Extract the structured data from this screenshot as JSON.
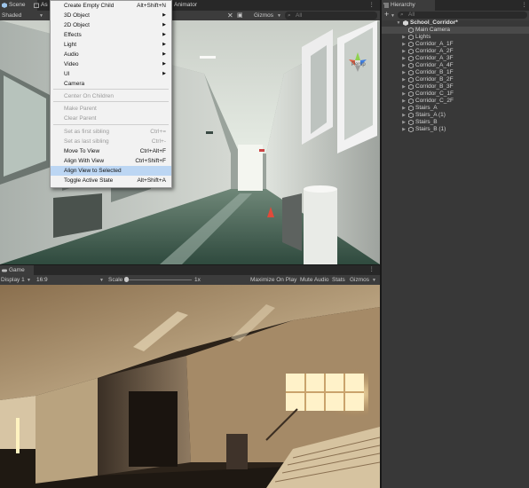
{
  "scene_tabs": {
    "scene": "Scene",
    "asset": "As",
    "animator": "Animator"
  },
  "scene_toolbar": {
    "shading_mode": "Shaded",
    "gizmos": "Gizmos",
    "search_placeholder": "All"
  },
  "scene_gizmo": {
    "projection": "Persp"
  },
  "context_menu": {
    "items": [
      {
        "label": "Create Empty Child",
        "shortcut": "Alt+Shift+N",
        "disabled": false,
        "submenu": false,
        "highlighted": false
      },
      {
        "label": "3D Object",
        "shortcut": "",
        "disabled": false,
        "submenu": true,
        "highlighted": false
      },
      {
        "label": "2D Object",
        "shortcut": "",
        "disabled": false,
        "submenu": true,
        "highlighted": false
      },
      {
        "label": "Effects",
        "shortcut": "",
        "disabled": false,
        "submenu": true,
        "highlighted": false
      },
      {
        "label": "Light",
        "shortcut": "",
        "disabled": false,
        "submenu": true,
        "highlighted": false
      },
      {
        "label": "Audio",
        "shortcut": "",
        "disabled": false,
        "submenu": true,
        "highlighted": false
      },
      {
        "label": "Video",
        "shortcut": "",
        "disabled": false,
        "submenu": true,
        "highlighted": false
      },
      {
        "label": "UI",
        "shortcut": "",
        "disabled": false,
        "submenu": true,
        "highlighted": false
      },
      {
        "label": "Camera",
        "shortcut": "",
        "disabled": false,
        "submenu": false,
        "highlighted": false
      },
      {
        "label": "Center On Children",
        "shortcut": "",
        "disabled": true,
        "submenu": false,
        "highlighted": false
      },
      {
        "label": "Make Parent",
        "shortcut": "",
        "disabled": true,
        "submenu": false,
        "highlighted": false
      },
      {
        "label": "Clear Parent",
        "shortcut": "",
        "disabled": true,
        "submenu": false,
        "highlighted": false
      },
      {
        "label": "Set as first sibling",
        "shortcut": "Ctrl+=",
        "disabled": true,
        "submenu": false,
        "highlighted": false
      },
      {
        "label": "Set as last sibling",
        "shortcut": "Ctrl+-",
        "disabled": true,
        "submenu": false,
        "highlighted": false
      },
      {
        "label": "Move To View",
        "shortcut": "Ctrl+Alt+F",
        "disabled": false,
        "submenu": false,
        "highlighted": false
      },
      {
        "label": "Align With View",
        "shortcut": "Ctrl+Shift+F",
        "disabled": false,
        "submenu": false,
        "highlighted": false
      },
      {
        "label": "Align View to Selected",
        "shortcut": "",
        "disabled": false,
        "submenu": false,
        "highlighted": true
      },
      {
        "label": "Toggle Active State",
        "shortcut": "Alt+Shift+A",
        "disabled": false,
        "submenu": false,
        "highlighted": false
      }
    ]
  },
  "game_panel": {
    "tab": "Game",
    "display": "Display 1",
    "aspect": "16:9",
    "scale_label": "Scale",
    "scale_value": 0.0,
    "scale_readout": "1x",
    "maximize": "Maximize On Play",
    "mute": "Mute Audio",
    "stats": "Stats",
    "gizmos": "Gizmos"
  },
  "hierarchy": {
    "title": "Hierarchy",
    "search_placeholder": "All",
    "scene_name": "School_Corridor*",
    "items": [
      {
        "label": "Main Camera",
        "selected": true,
        "expandable": false
      },
      {
        "label": "Lights",
        "selected": false,
        "expandable": true
      },
      {
        "label": "Corridor_A_1F",
        "selected": false,
        "expandable": true
      },
      {
        "label": "Corridor_A_2F",
        "selected": false,
        "expandable": true
      },
      {
        "label": "Corridor_A_3F",
        "selected": false,
        "expandable": true
      },
      {
        "label": "Corridor_A_4F",
        "selected": false,
        "expandable": true
      },
      {
        "label": "Corridor_B_1F",
        "selected": false,
        "expandable": true
      },
      {
        "label": "Corridor_B_2F",
        "selected": false,
        "expandable": true
      },
      {
        "label": "Corridor_B_3F",
        "selected": false,
        "expandable": true
      },
      {
        "label": "Corridor_C_1F",
        "selected": false,
        "expandable": true
      },
      {
        "label": "Corridor_C_2F",
        "selected": false,
        "expandable": true
      },
      {
        "label": "Stairs_A",
        "selected": false,
        "expandable": true
      },
      {
        "label": "Stairs_A (1)",
        "selected": false,
        "expandable": true
      },
      {
        "label": "Stairs_B",
        "selected": false,
        "expandable": true
      },
      {
        "label": "Stairs_B (1)",
        "selected": false,
        "expandable": true
      }
    ]
  },
  "colors": {
    "menu_highlight": "#bcd6f3",
    "panel_bg": "#383838",
    "toolbar_bg": "#3c3c3c"
  }
}
